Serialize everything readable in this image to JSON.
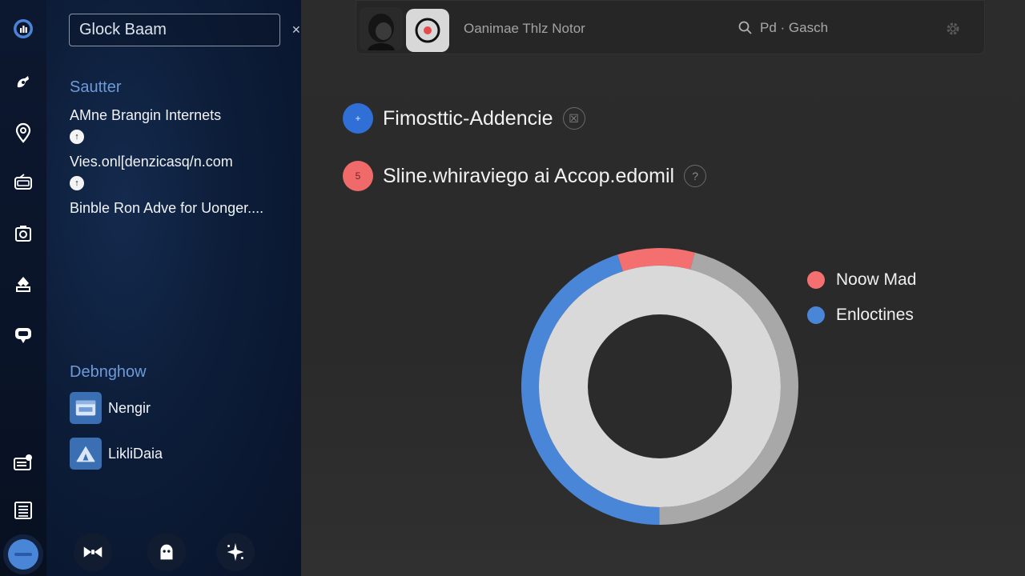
{
  "sidebar": {
    "search": {
      "value": "Glock Baam",
      "clear_icon": "close-icon"
    },
    "section1_title": "Sautter",
    "recent": [
      {
        "label": "AMne Brangin Internets",
        "badge": "↑"
      },
      {
        "label": "Vies.onl[denzicasq/n.com",
        "badge": "↑"
      },
      {
        "label": "Binble Ron Adve for Uonger...."
      }
    ],
    "section2_title": "Debnghow",
    "apps": [
      {
        "label": "Nengir",
        "icon": "window-icon"
      },
      {
        "label": "LikliDaia",
        "icon": "tent-icon"
      }
    ]
  },
  "rail": {
    "icons": [
      "dashboard-icon",
      "pin-icon",
      "location-icon",
      "radio-icon",
      "camera-icon",
      "rocket-icon",
      "message-icon",
      "news-icon",
      "list-icon",
      "profile-icon"
    ]
  },
  "panel_bottom": {
    "icons": [
      "bowtie-icon",
      "face-icon",
      "sparkle-icon"
    ]
  },
  "topbar": {
    "title": "Oanimae Thlz Notor",
    "search_label": "Pd · Gasch",
    "search_icon": "search-icon",
    "settings_icon": "gear-icon"
  },
  "main": {
    "rows": [
      {
        "text": "Fimosttic-Addencie",
        "badge": "+",
        "badge_color": "#2f6fd6",
        "help": "☒"
      },
      {
        "text": "Sline.whiraviego ai Accop.edomil",
        "badge": "5",
        "badge_color": "#f06a6a",
        "help": "?"
      }
    ]
  },
  "colors": {
    "accent_blue": "#4a86d8",
    "accent_red": "#f47070",
    "ring_grey": "#a8a8a8",
    "disc": "#d9d9d9"
  },
  "chart_data": {
    "type": "pie",
    "variant": "donut",
    "legend_position": "right",
    "series": [
      {
        "name": "Noow Mad",
        "value": 9,
        "color": "#f47070"
      },
      {
        "name": "Enloctines",
        "value": 45,
        "color": "#4a86d8"
      }
    ],
    "remainder": {
      "value": 46,
      "color": "#a8a8a8"
    }
  }
}
